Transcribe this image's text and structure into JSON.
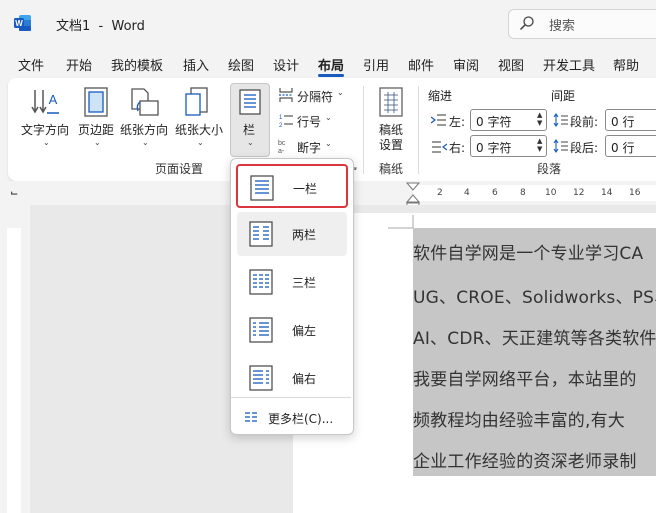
{
  "titlebar": {
    "doc_title": "文档1  -  Word",
    "search_placeholder": "搜索"
  },
  "menu": {
    "tabs": [
      "文件",
      "开始",
      "我的模板",
      "插入",
      "绘图",
      "设计",
      "布局",
      "引用",
      "邮件",
      "审阅",
      "视图",
      "开发工具",
      "帮助"
    ],
    "active_tab": "布局"
  },
  "ribbon": {
    "page_setup": {
      "text_direction": "文字方向",
      "margins": "页边距",
      "orientation": "纸张方向",
      "size": "纸张大小",
      "columns": "栏",
      "breaks": "分隔符",
      "line_numbers": "行号",
      "hyphenation": "断字",
      "group_label": "页面设置"
    },
    "manuscript": {
      "setting_line1": "稿纸",
      "setting_line2": "设置",
      "group_label": "稿纸"
    },
    "paragraph": {
      "indent_label": "缩进",
      "spacing_label": "间距",
      "left_label": "左:",
      "right_label": "右:",
      "left_value": "0 字符",
      "right_value": "0 字符",
      "before_label": "段前:",
      "after_label": "段后:",
      "before_value": "0 行",
      "after_value": "0 行",
      "group_label": "段落"
    }
  },
  "ruler": {
    "numbers": [
      "2",
      "4",
      "6",
      "8",
      "10",
      "12",
      "14",
      "16"
    ]
  },
  "document": {
    "lines": [
      "软件自学网是一个专业学习CA",
      "UG、CROE、Solidworks、PS、offi",
      "AI、CDR、天正建筑等各类软件",
      "我要自学网络平台，本站里的",
      "频教程均由经验丰富的,有大",
      "企业工作经验的资深老师录制"
    ]
  },
  "columns_menu": {
    "items": [
      "一栏",
      "两栏",
      "三栏",
      "偏左",
      "偏右"
    ],
    "more": "更多栏(C)..."
  },
  "colors": {
    "accent": "#185abd",
    "highlight_border": "#d9363e",
    "word_blue": "#185abd"
  }
}
